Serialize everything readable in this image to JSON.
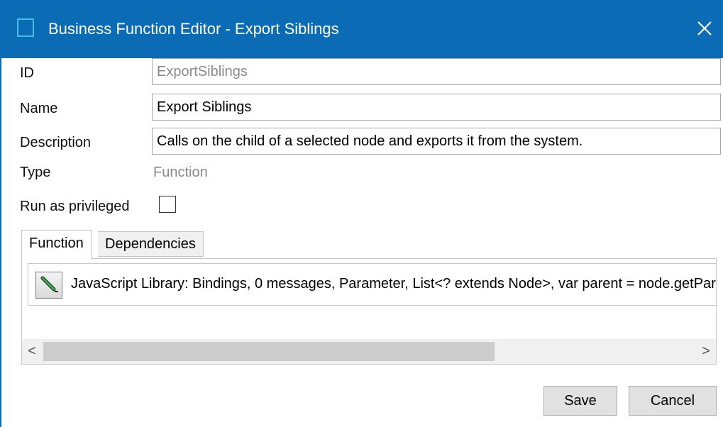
{
  "window": {
    "title": "Business Function Editor - Export Siblings",
    "accent_color": "#0b6bb5",
    "app_icon": "window-square-icon",
    "close_icon": "close-x-icon"
  },
  "form": {
    "id_label": "ID",
    "id_value": "ExportSiblings",
    "name_label": "Name",
    "name_value": "Export Siblings",
    "description_label": "Description",
    "description_value": "Calls on the child of a selected node and exports it from the system.",
    "type_label": "Type",
    "type_value": "Function",
    "privileged_label": "Run as privileged",
    "privileged_checked": false
  },
  "tabs": [
    {
      "label": "Function",
      "active": true
    },
    {
      "label": "Dependencies",
      "active": false
    }
  ],
  "function_panel": {
    "edit_icon": "pencil-edit-icon",
    "summary": "JavaScript Library: Bindings, 0 messages, Parameter, List<? extends Node>, var parent = node.getParent();"
  },
  "scrollbar": {
    "left_arrow": "<",
    "right_arrow": ">"
  },
  "buttons": {
    "save_label": "Save",
    "cancel_label": "Cancel"
  }
}
